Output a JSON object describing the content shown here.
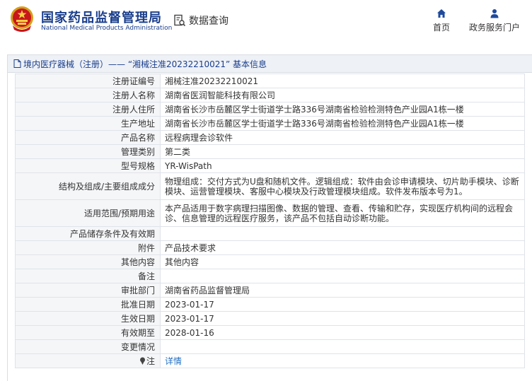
{
  "header": {
    "org_name_cn": "国家药品监督管理局",
    "org_name_en": "National Medical Products Administration",
    "query_label": "数据查询",
    "nav": [
      {
        "label": "首页",
        "icon": "home-icon"
      },
      {
        "label": "政务服务门户",
        "icon": "user-icon"
      }
    ]
  },
  "breadcrumb": {
    "text": "境内医疗器械（注册）——  “湘械注准20232210021” 基本信息"
  },
  "rows": [
    {
      "label": "注册证编号",
      "value": "湘械注准20232210021"
    },
    {
      "label": "注册人名称",
      "value": "湖南省医润智能科技有限公司"
    },
    {
      "label": "注册人住所",
      "value": "湖南省长沙市岳麓区学士街道学士路336号湖南省检验检测特色产业园A1栋一楼"
    },
    {
      "label": "生产地址",
      "value": "湖南省长沙市岳麓区学士街道学士路336号湖南省检验检测特色产业园A1栋一楼"
    },
    {
      "label": "产品名称",
      "value": "远程病理会诊软件"
    },
    {
      "label": "管理类别",
      "value": "第二类"
    },
    {
      "label": "型号规格",
      "value": "YR-WisPath"
    },
    {
      "label": "结构及组成/主要组成成分",
      "value": "物理组成：交付方式为U盘和随机文件。逻辑组成：软件由会诊申请模块、切片助手模块、诊断模块、运营管理模块、客服中心模块及行政管理模块组成。软件发布版本号为1。"
    },
    {
      "label": "适用范围/预期用途",
      "value": "本产品适用于数字病理扫描图像、数据的管理、查看、传输和贮存，实现医疗机构间的远程会诊、信息管理的远程医疗服务，该产品不包括自动诊断功能。"
    },
    {
      "label": "产品储存条件及有效期",
      "value": ""
    },
    {
      "label": "附件",
      "value": "产品技术要求"
    },
    {
      "label": "其他内容",
      "value": "其他内容"
    },
    {
      "label": "备注",
      "value": ""
    },
    {
      "label": "审批部门",
      "value": "湖南省药品监督管理局"
    },
    {
      "label": "批准日期",
      "value": "2023-01-17"
    },
    {
      "label": "生效日期",
      "value": "2023-01-17"
    },
    {
      "label": "有效期至",
      "value": "2028-01-16"
    },
    {
      "label": "变更情况",
      "value": ""
    }
  ],
  "note_row": {
    "label": "注",
    "value": "详情"
  }
}
